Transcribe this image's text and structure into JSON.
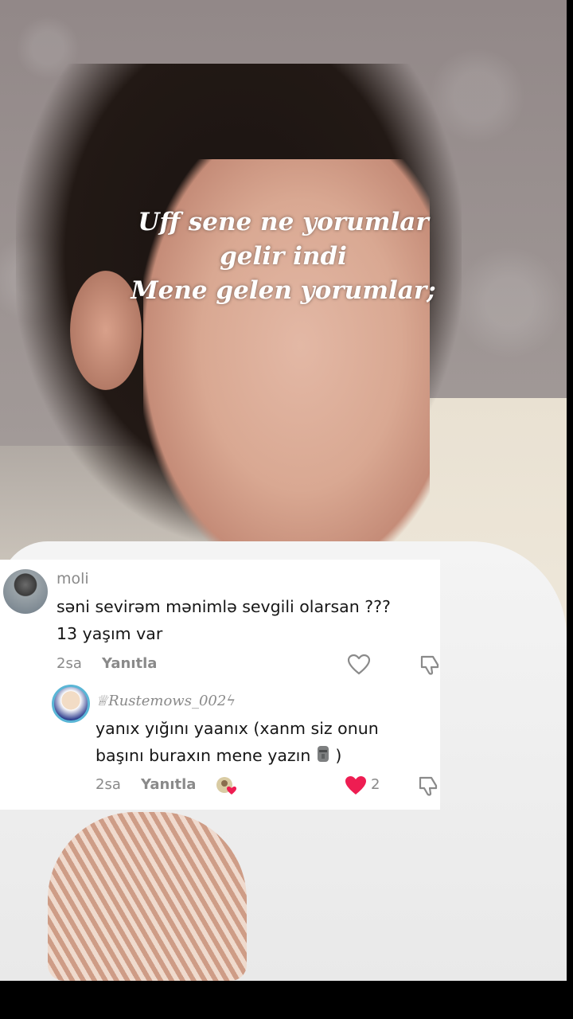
{
  "overlay": {
    "caption_lines": [
      "Uff sene ne yorumlar",
      "gelir indi",
      "Mene gelen yorumlar;"
    ]
  },
  "comment": {
    "username": "moli",
    "text_line1": "səni sevirəm mənimlə sevgili olarsan ???",
    "text_line2": "13 yaşım var",
    "time": "2sa",
    "reply_label": "Yanıtla"
  },
  "reply": {
    "username": "♕Rustemows_002ϟ",
    "text_line1": "yanıx yığını yaanıx (xanm siz onun",
    "text_line2": "başını buraxın mene yazın",
    "text_suffix": ")",
    "time": "2sa",
    "reply_label": "Yanıtla",
    "like_count": "2",
    "liked": true
  },
  "colors": {
    "heart_red": "#ee1d52",
    "meta_gray": "#8a8a8a",
    "text_dark": "#161616"
  }
}
